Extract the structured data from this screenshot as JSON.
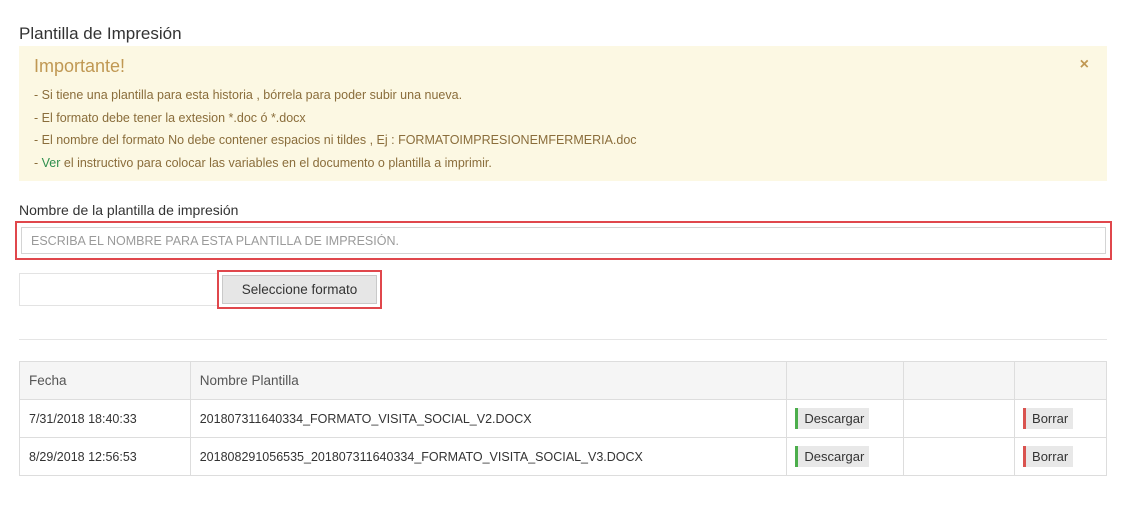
{
  "page": {
    "title": "Plantilla de Impresión"
  },
  "alert": {
    "title": "Importante!",
    "close": "×",
    "lines": [
      "- Si tiene una plantilla para esta historia , bórrela para poder subir una nueva.",
      "- El formato debe tener la extesion *.doc ó *.docx",
      "- El nombre del formato No debe contener espacios ni tildes , Ej : FORMATOIMPRESIONEMFERMERIA.doc"
    ],
    "last_line_prefix": "- ",
    "link_text": "Ver",
    "last_line_rest": " el instructivo para colocar las variables en el documento o plantilla a imprimir."
  },
  "form": {
    "name_label": "Nombre de la plantilla de impresión",
    "name_placeholder": "ESCRIBA EL NOMBRE PARA ESTA PLANTILLA DE IMPRESIÓN.",
    "name_value": "",
    "file_value": "",
    "select_button": "Seleccione formato"
  },
  "table": {
    "headers": [
      "Fecha",
      "Nombre Plantilla",
      "",
      "",
      ""
    ],
    "rows": [
      {
        "fecha": "7/31/2018 18:40:33",
        "nombre": "201807311640334_FORMATO_VISITA_SOCIAL_V2.DOCX",
        "download": "Descargar",
        "delete": "Borrar"
      },
      {
        "fecha": "8/29/2018 12:56:53",
        "nombre": "201808291056535_201807311640334_FORMATO_VISITA_SOCIAL_V3.DOCX",
        "download": "Descargar",
        "delete": "Borrar"
      }
    ]
  },
  "colors": {
    "alert_bg": "#fcf8e3",
    "alert_text": "#8a6d3b",
    "link": "#2f8f4e",
    "highlight": "#e0474c",
    "download_accent": "#4cae4c",
    "delete_accent": "#d9534f"
  }
}
